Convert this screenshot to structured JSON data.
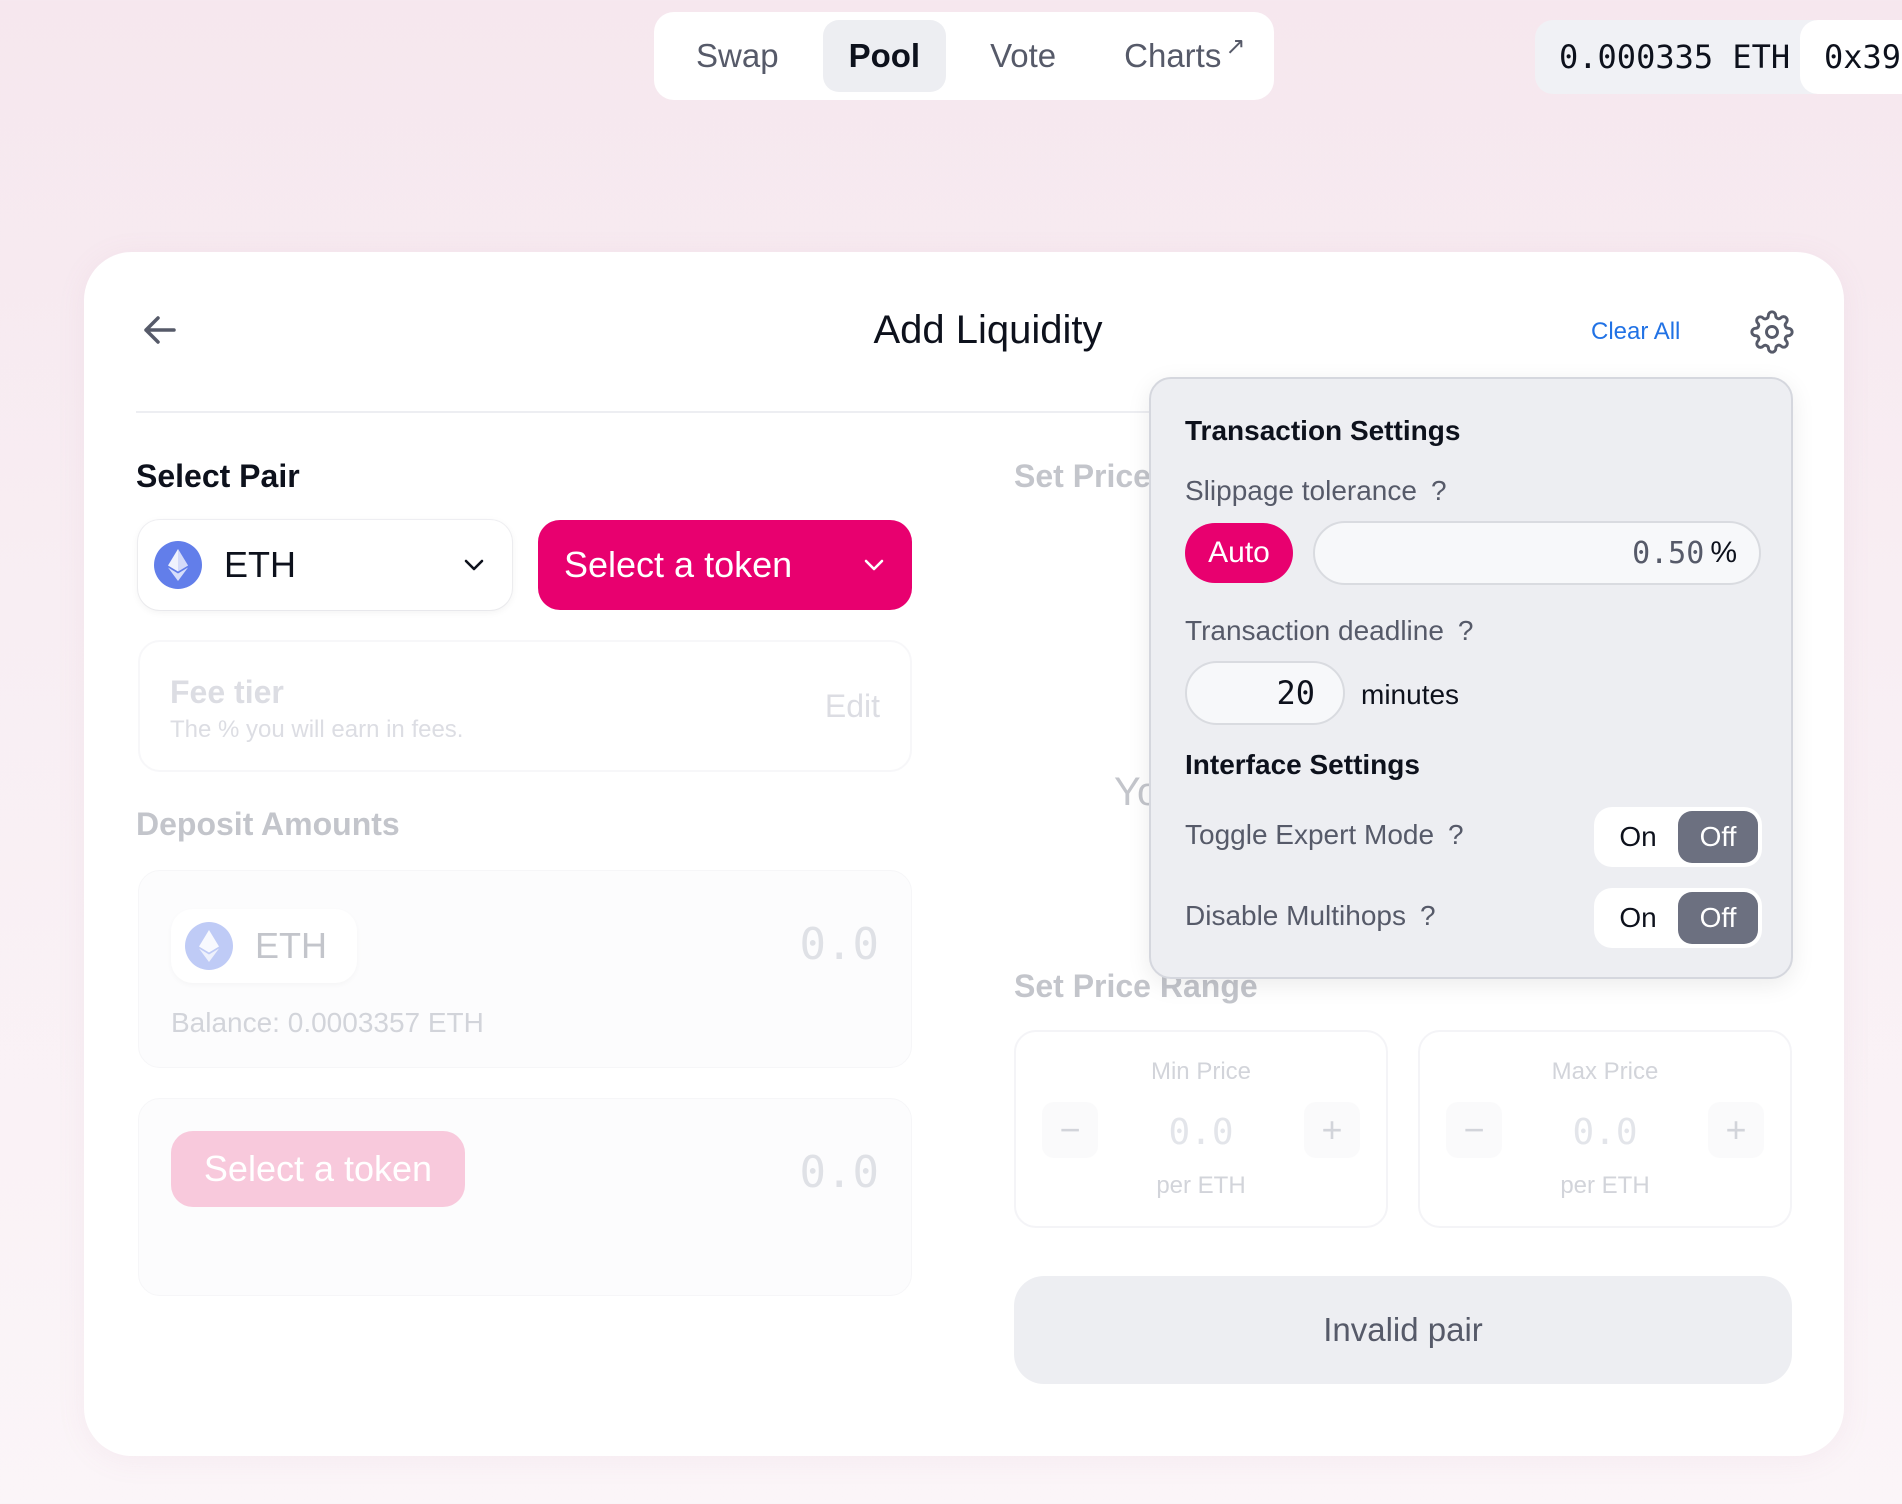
{
  "nav": {
    "items": [
      {
        "label": "Swap"
      },
      {
        "label": "Pool"
      },
      {
        "label": "Vote"
      },
      {
        "label": "Charts",
        "suffix": "↗"
      }
    ],
    "active": "Pool"
  },
  "wallet": {
    "balance": "0.000335 ETH",
    "address": "0x39"
  },
  "card": {
    "title": "Add Liquidity",
    "clear_all": "Clear All",
    "select_pair_label": "Select Pair",
    "token_a": "ETH",
    "token_b_placeholder": "Select a token",
    "fee_tier_title": "Fee tier",
    "fee_tier_sub": "The % you will earn in fees.",
    "fee_edit": "Edit",
    "deposit_label": "Deposit Amounts",
    "deposit_a_token": "ETH",
    "deposit_a_amount": "0.0",
    "deposit_a_balance": "Balance: 0.0003357 ETH",
    "deposit_b_select": "Select a token",
    "deposit_b_amount": "0.0",
    "set_price_label": "Set Price",
    "partial_text": "Yo",
    "set_price_range_label": "Set Price Range",
    "min_price": {
      "title": "Min Price",
      "value": "0.0",
      "unit": "per ETH",
      "minus": "−",
      "plus": "+"
    },
    "max_price": {
      "title": "Max Price",
      "value": "0.0",
      "unit": "per ETH",
      "minus": "−",
      "plus": "+"
    },
    "submit": "Invalid pair"
  },
  "settings": {
    "tx_title": "Transaction Settings",
    "slippage_label": "Slippage tolerance",
    "help": "?",
    "auto": "Auto",
    "slippage_value": "0.50",
    "percent": "%",
    "deadline_label": "Transaction deadline",
    "deadline_value": "20",
    "deadline_unit": "minutes",
    "interface_title": "Interface Settings",
    "expert_label": "Toggle Expert Mode",
    "multihop_label": "Disable Multihops",
    "on": "On",
    "off": "Off"
  },
  "colors": {
    "accent": "#e8006f",
    "link": "#2172e5",
    "eth": "#627eea"
  },
  "icons": [
    "back-arrow-icon",
    "gear-icon",
    "eth-icon",
    "chevron-down-icon",
    "external-link-icon"
  ]
}
